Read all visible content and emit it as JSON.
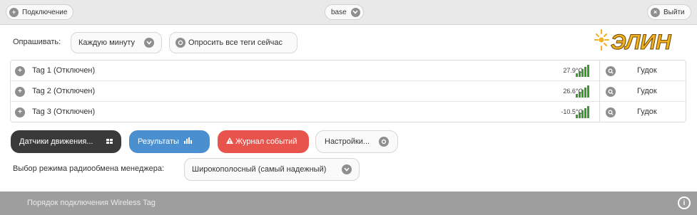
{
  "topbar": {
    "connect_label": "Подключение",
    "base_label": "base",
    "logout_label": "Выйти"
  },
  "polling": {
    "label": "Опрашивать:",
    "interval_value": "Каждую минуту",
    "poll_all_label": "Опросить все теги сейчас"
  },
  "brand": {
    "logo_text": "ЭЛИН",
    "accent": "#f2b01e"
  },
  "tags": [
    {
      "name": "Tag 1 (Отключен)",
      "temp": "27.9°C",
      "beep": "Гудок"
    },
    {
      "name": "Tag 2 (Отключен)",
      "temp": "26.6°C",
      "beep": "Гудок"
    },
    {
      "name": "Tag 3 (Отключен)",
      "temp": "-10.5°C",
      "beep": "Гудок"
    }
  ],
  "actions": {
    "motion_sensors": "Датчики движения...",
    "results": "Результаты",
    "event_log": "Журнал событий",
    "settings": "Настройки..."
  },
  "radio_mode": {
    "label": "Выбор режима радиообмена менеджера:",
    "value": "Широкополосный (самый надежный)"
  },
  "footer": {
    "title": "Порядок подключения Wireless Tag"
  },
  "colors": {
    "dark_button": "#3a3a3a",
    "blue_button": "#4a8fd0",
    "red_button": "#e8544c",
    "signal": "#3a9a2e",
    "footer_bg": "#9e9e9e"
  }
}
